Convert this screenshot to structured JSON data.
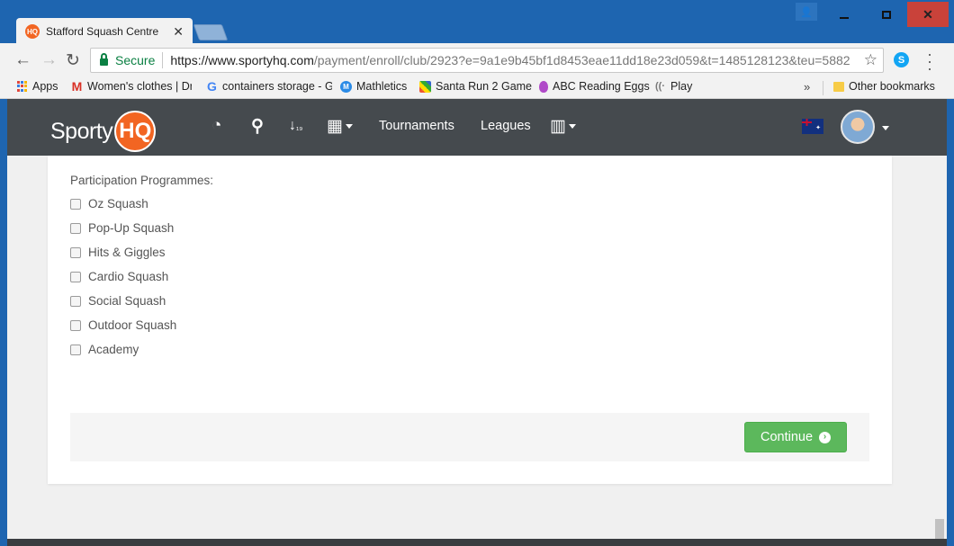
{
  "browser": {
    "tab_title": "Stafford Squash Centre M",
    "tab_favicon": "HQ",
    "url_secure_label": "Secure",
    "url_host": "https://www.sportyhq.com",
    "url_path": "/payment/enroll/club/2923?e=9a1e9b45bf1d8453eae11dd18e23d059&t=1485128123&teu=5882",
    "bookmarks": [
      {
        "label": "Apps",
        "icon": "apps-grid-icon"
      },
      {
        "label": "Women's clothes | Dre",
        "icon": "gmail-icon"
      },
      {
        "label": "containers storage - G",
        "icon": "google-icon"
      },
      {
        "label": "Mathletics",
        "icon": "mathletics-icon"
      },
      {
        "label": "Santa Run 2 Game",
        "icon": "game-icon"
      },
      {
        "label": "ABC Reading Eggs",
        "icon": "egg-icon"
      },
      {
        "label": "Play",
        "icon": "play-icon"
      }
    ],
    "other_bookmarks": "Other bookmarks"
  },
  "site_nav": {
    "logo_text": "Sporty",
    "logo_badge": "HQ",
    "tournaments": "Tournaments",
    "leagues": "Leagues"
  },
  "form": {
    "section_label": "Participation Programmes:",
    "programmes": [
      {
        "label": "Oz Squash",
        "checked": false
      },
      {
        "label": "Pop-Up Squash",
        "checked": false
      },
      {
        "label": "Hits & Giggles",
        "checked": false
      },
      {
        "label": "Cardio Squash",
        "checked": false
      },
      {
        "label": "Social Squash",
        "checked": false
      },
      {
        "label": "Outdoor Squash",
        "checked": false
      },
      {
        "label": "Academy",
        "checked": false
      }
    ],
    "continue_label": "Continue"
  },
  "colors": {
    "brand_orange": "#f26522",
    "nav_bg": "#454a4e",
    "continue_green": "#5cb85c",
    "window_blue": "#1e65b0"
  }
}
